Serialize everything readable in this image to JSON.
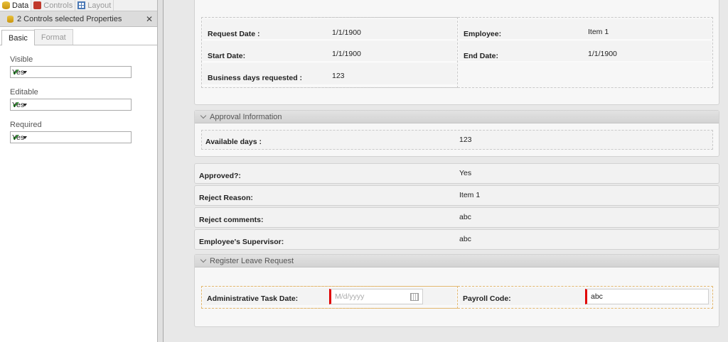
{
  "toptabs": [
    {
      "label": "Data",
      "icon": "database-icon",
      "active": true
    },
    {
      "label": "Controls",
      "icon": "toolbox-icon",
      "active": false
    },
    {
      "label": "Layout",
      "icon": "grid-icon",
      "active": false
    }
  ],
  "props": {
    "header": "2 Controls selected Properties",
    "tabs": {
      "basic": "Basic",
      "format": "Format"
    },
    "visible": {
      "label": "Visible",
      "value": "Yes"
    },
    "editable": {
      "label": "Editable",
      "value": "Yes"
    },
    "required": {
      "label": "Required",
      "value": "Yes"
    }
  },
  "request": {
    "request_date_label": "Request Date :",
    "request_date_value": "1/1/1900",
    "start_date_label": "Start Date:",
    "start_date_value": "1/1/1900",
    "business_days_label": "Business days requested :",
    "business_days_value": "123",
    "employee_label": "Employee:",
    "employee_value": "Item 1",
    "end_date_label": "End Date:",
    "end_date_value": "1/1/1900"
  },
  "approval": {
    "title": "Approval Information",
    "available_days_label": "Available days :",
    "available_days_value": "123"
  },
  "decision": {
    "approved_label": "Approved?:",
    "approved_value": "Yes",
    "reject_reason_label": "Reject Reason:",
    "reject_reason_value": "Item 1",
    "reject_comments_label": "Reject comments:",
    "reject_comments_value": "abc",
    "supervisor_label": "Employee's Supervisor:",
    "supervisor_value": "abc"
  },
  "register": {
    "title": "Register Leave Request",
    "admin_date_label": "Administrative Task Date:",
    "admin_date_placeholder": "M/d/yyyy",
    "payroll_label": "Payroll Code:",
    "payroll_value": "abc"
  }
}
